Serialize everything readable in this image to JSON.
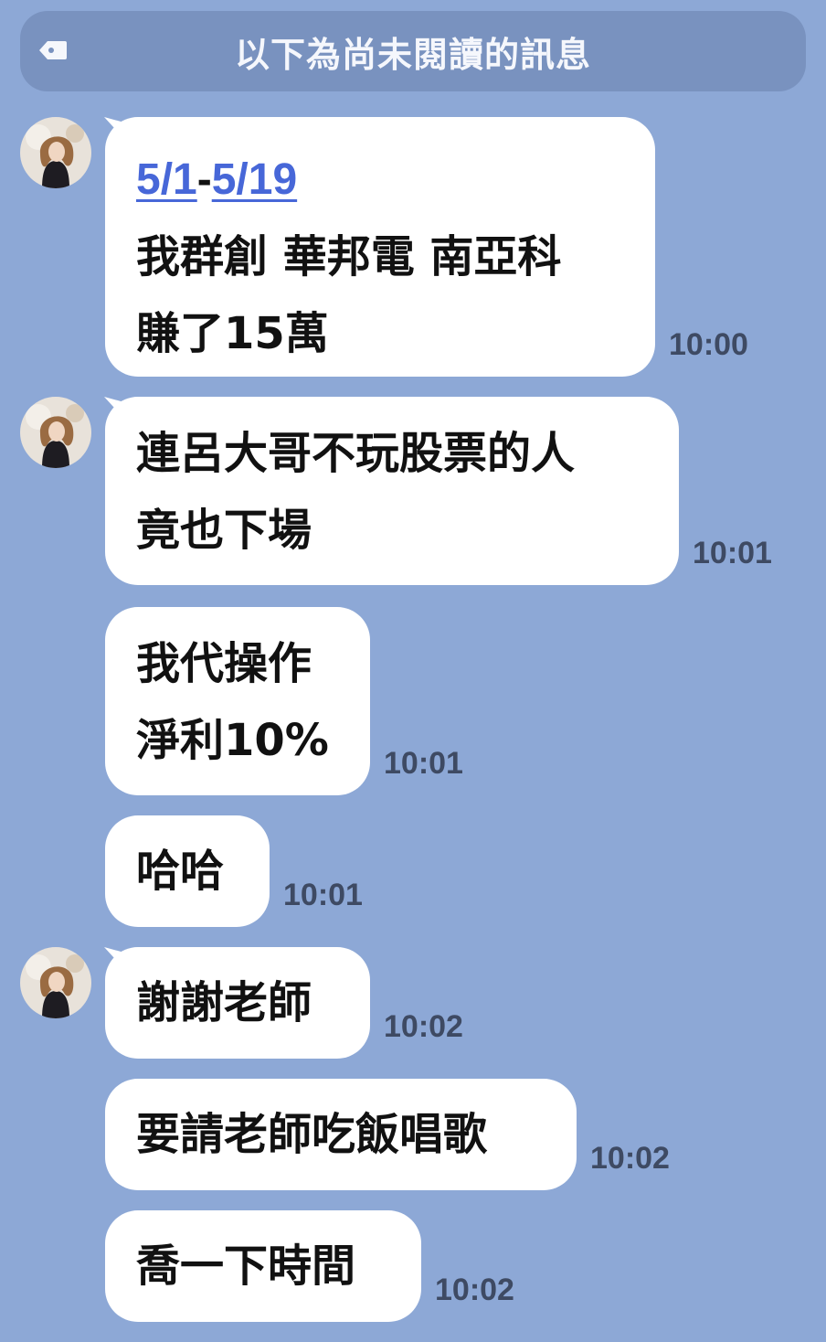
{
  "banner": {
    "text": "以下為尚未閱讀的訊息",
    "icon": "tag-icon"
  },
  "messages": [
    {
      "date_start": "5/1",
      "dash": "-",
      "date_end": "5/19",
      "lines": [
        "我群創 華邦電 南亞科",
        "賺了15萬"
      ],
      "time": "10:00"
    },
    {
      "lines": [
        "連呂大哥不玩股票的人",
        "竟也下場"
      ],
      "time": "10:01"
    },
    {
      "lines": [
        "我代操作",
        "淨利10%"
      ],
      "time": "10:01"
    },
    {
      "lines": [
        "哈哈"
      ],
      "time": "10:01"
    },
    {
      "lines": [
        "謝謝老師"
      ],
      "time": "10:02"
    },
    {
      "lines": [
        "要請老師吃飯唱歌"
      ],
      "time": "10:02"
    },
    {
      "lines": [
        "喬一下時間"
      ],
      "time": "10:02"
    }
  ],
  "colors": {
    "background": "#8DA8D6",
    "banner": "#7992BF",
    "bubble": "#FFFFFF",
    "link": "#4767D8",
    "time": "#3E4A63"
  }
}
